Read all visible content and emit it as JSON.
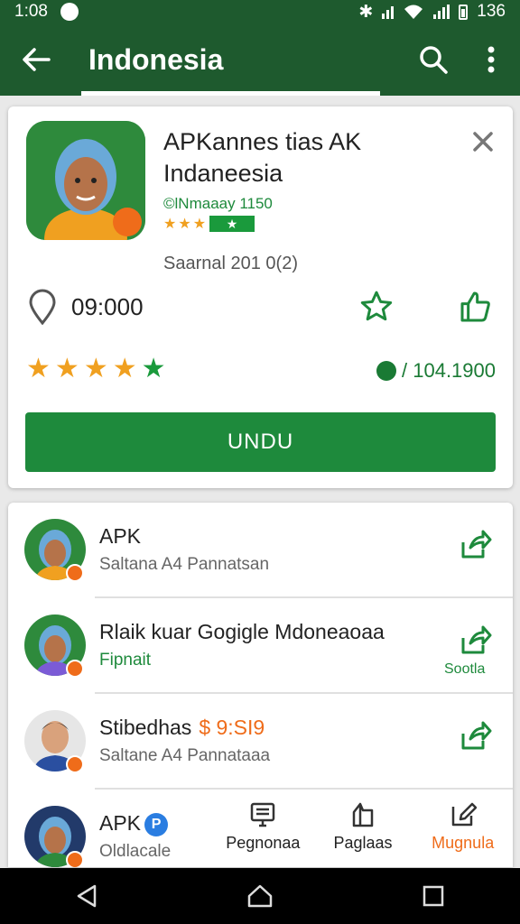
{
  "status_bar": {
    "time": "1:0",
    "time_suffix": "8",
    "clock_right": "136"
  },
  "app_bar": {
    "title": "Indonesia"
  },
  "featured": {
    "title_line1": "APKannes tias AK",
    "title_line2": "Indaneesia",
    "developer": "©lNmaaay 1150",
    "badge_text": "★",
    "size_text": "Saarnal 201 0(2)",
    "location_value": "09:000",
    "downloads": "/ 104.1900",
    "rating_stars": 5,
    "install_label": "UNDU"
  },
  "list": [
    {
      "title": "APK",
      "subtitle": "Saltana A4 Pannatsan",
      "action_label": ""
    },
    {
      "title": "Rlaik kuar Gogigle Mdoneaoaa",
      "subtitle": "Fipnait",
      "action_label": "Sootla"
    },
    {
      "title": "Stibedhas",
      "price": "$ 9:SI9",
      "subtitle": "Saltane A4 Pannataaa",
      "action_label": ""
    },
    {
      "title": "APK",
      "badge": "P",
      "subtitle": "Oldlacale",
      "action_label": ""
    }
  ],
  "bottom_tabs": [
    {
      "label": "Pegnonaa",
      "icon": "monitor-icon",
      "active": false
    },
    {
      "label": "Paglaas",
      "icon": "bookmark-icon",
      "active": false
    },
    {
      "label": "Mugnula",
      "icon": "edit-icon",
      "active": true
    }
  ],
  "colors": {
    "primary": "#1e5a2e",
    "accent_green": "#1e8a3c",
    "star": "#f0a020",
    "orange": "#ef6c1a"
  }
}
